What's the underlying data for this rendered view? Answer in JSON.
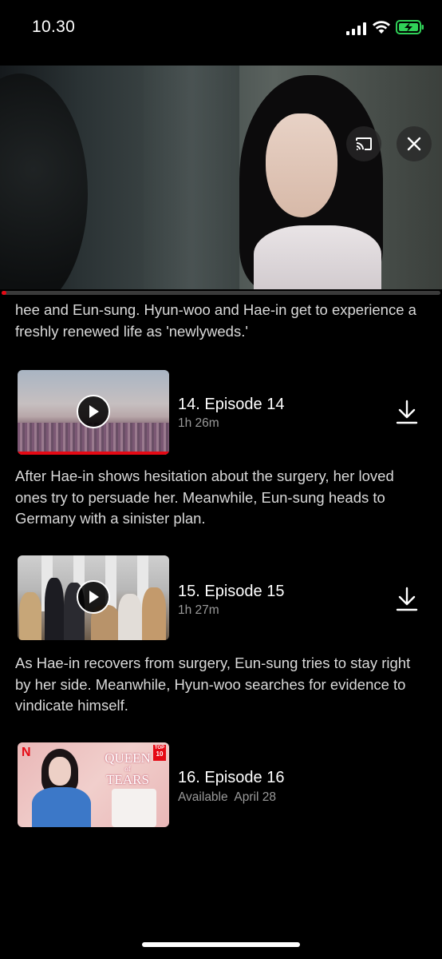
{
  "status_bar": {
    "time": "10.30",
    "battery_color": "#30d158"
  },
  "player": {
    "cast_icon": "cast-icon",
    "close_icon": "close-icon",
    "mute_icon": "speaker-muted-icon",
    "progress_fraction": 0.01,
    "accent": "#e50914"
  },
  "episodes": {
    "prev_description": "hee and Eun-sung. Hyun-woo and Hae-in get to experience a freshly renewed life as 'newlyweds.'",
    "items": [
      {
        "title": "14. Episode 14",
        "duration": "1h 26m",
        "description": "After Hae-in shows hesitation about the surgery, her loved ones try to persuade her. Meanwhile, Eun-sung heads to Germany with a sinister plan.",
        "watched_fraction": 1.0,
        "download_icon": "download-icon"
      },
      {
        "title": "15. Episode 15",
        "duration": "1h 27m",
        "description": "As Hae-in recovers from surgery, Eun-sung tries to stay right by her side. Meanwhile, Hyun-woo searches for evidence to vindicate himself.",
        "download_icon": "download-icon"
      },
      {
        "title": "16. Episode 16",
        "availability_label": "Available",
        "availability_date": "April 28",
        "poster_logo": "N",
        "poster_badge_top": "TOP",
        "poster_badge_num": "10",
        "poster_title_1": "QUEEN",
        "poster_title_of": "of",
        "poster_title_2": "TEARS"
      }
    ]
  }
}
